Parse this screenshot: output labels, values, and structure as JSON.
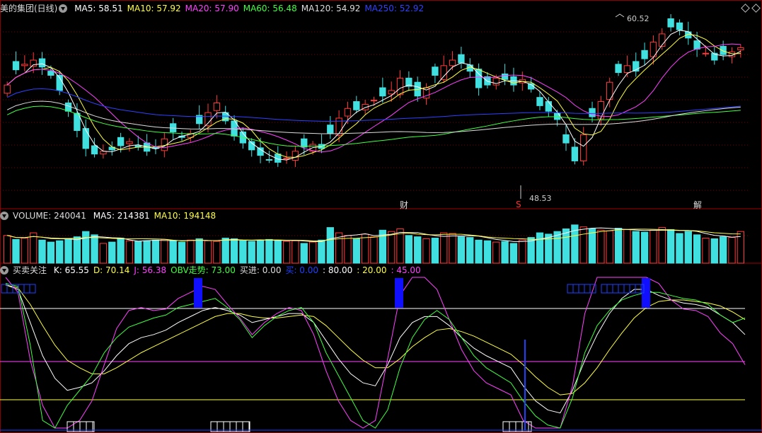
{
  "price_panel": {
    "title": "美的集团(日线)",
    "ma": [
      {
        "label": "MA5: 58.51",
        "color": "#ffffff"
      },
      {
        "label": "MA10: 57.92",
        "color": "#ffff40"
      },
      {
        "label": "MA20: 57.90",
        "color": "#ff40ff"
      },
      {
        "label": "MA60: 56.48",
        "color": "#40ff40"
      },
      {
        "label": "MA120: 54.92",
        "color": "#dddddd"
      },
      {
        "label": "MA250: 52.92",
        "color": "#3040ff"
      }
    ],
    "high_label": "60.52",
    "low_label": "48.53",
    "events": [
      {
        "text": "财",
        "color": "#e0e0e0"
      },
      {
        "text": "S",
        "color": "#ff3030"
      },
      {
        "text": "解",
        "color": "#e0e0e0"
      }
    ]
  },
  "volume_panel": {
    "title": "VOLUME: 240041",
    "ma": [
      {
        "label": "MA5: 214381",
        "color": "#ffffff"
      },
      {
        "label": "MA10: 194148",
        "color": "#ffff40"
      }
    ]
  },
  "indicator_panel": {
    "title": "买卖关注",
    "fields": [
      {
        "label": "K: 65.55",
        "color": "#ffffff"
      },
      {
        "label": "D: 70.14",
        "color": "#ffff40"
      },
      {
        "label": "J: 56.38",
        "color": "#ff40ff"
      },
      {
        "label": "OBV走势: 73.00",
        "color": "#40ff40"
      },
      {
        "label": "买进: 0.00",
        "color": "#dddddd"
      },
      {
        "label": "买: 0.00",
        "color": "#2040ff"
      },
      {
        "label": ": 80.00",
        "color": "#ffffff"
      },
      {
        "label": ": 20.00",
        "color": "#ffff40"
      },
      {
        "label": ": 45.00",
        "color": "#ff40ff"
      }
    ]
  },
  "chart_data": [
    {
      "type": "candlestick",
      "title": "美的集团(日线)",
      "bars": 85,
      "price_range": [
        48.53,
        60.52
      ],
      "close_series": [
        55.8,
        56.9,
        57.3,
        57.6,
        57.1,
        56.5,
        55.4,
        53.9,
        52.5,
        51.2,
        50.8,
        51.0,
        51.1,
        51.4,
        51.7,
        51.3,
        51.0,
        51.2,
        51.9,
        52.4,
        52.0,
        52.3,
        53.0,
        53.8,
        54.5,
        53.2,
        52.1,
        51.6,
        51.1,
        50.7,
        50.4,
        50.2,
        50.5,
        51.0,
        51.3,
        51.5,
        51.2,
        52.3,
        53.4,
        54.1,
        54.0,
        54.4,
        54.7,
        55.0,
        55.4,
        56.3,
        55.7,
        55.0,
        55.6,
        56.5,
        57.2,
        57.6,
        57.4,
        56.8,
        55.6,
        55.8,
        56.3,
        56.2,
        55.8,
        56.2,
        55.5,
        54.3,
        53.9,
        53.3,
        51.6,
        50.3,
        52.2,
        53.5,
        54.6,
        56.0,
        56.7,
        57.2,
        56.8,
        57.7,
        58.9,
        59.5,
        60.0,
        59.8,
        59.2,
        58.4,
        58.1,
        57.6,
        58.0,
        58.2,
        58.5
      ],
      "ma_values": {
        "MA5": 58.51,
        "MA10": 57.92,
        "MA20": 57.9,
        "MA60": 56.48,
        "MA120": 54.92,
        "MA250": 52.92
      }
    },
    {
      "type": "bar",
      "title": "VOLUME",
      "values": [
        210000,
        180000,
        190000,
        230000,
        175000,
        160000,
        170000,
        185000,
        200000,
        240000,
        215000,
        150000,
        160000,
        190000,
        170000,
        165000,
        170000,
        175000,
        180000,
        170000,
        160000,
        175000,
        185000,
        170000,
        165000,
        190000,
        185000,
        170000,
        165000,
        175000,
        180000,
        175000,
        165000,
        170000,
        150000,
        160000,
        175000,
        270000,
        230000,
        210000,
        185000,
        220000,
        200000,
        250000,
        240000,
        260000,
        210000,
        200000,
        185000,
        190000,
        230000,
        225000,
        200000,
        195000,
        175000,
        170000,
        160000,
        165000,
        150000,
        175000,
        195000,
        230000,
        220000,
        240000,
        260000,
        290000,
        275000,
        260000,
        250000,
        245000,
        265000,
        255000,
        240000,
        235000,
        250000,
        270000,
        255000,
        225000,
        240000,
        215000,
        190000,
        185000,
        200000,
        195000,
        240041
      ],
      "ma_values": {
        "MA5": 214381,
        "MA10": 194148
      }
    },
    {
      "type": "line",
      "title": "买卖关注",
      "series": [
        {
          "name": "K",
          "values": [
            95,
            92,
            70,
            48,
            33,
            25,
            27,
            30,
            38,
            48,
            56,
            60,
            62,
            65,
            70,
            74,
            78,
            80,
            78,
            75,
            70,
            72,
            74,
            76,
            76,
            70,
            58,
            46,
            36,
            30,
            28,
            42,
            60,
            70,
            74,
            74,
            68,
            60,
            53,
            48,
            44,
            40,
            28,
            18,
            12,
            10,
            25,
            45,
            62,
            76,
            86,
            92,
            92,
            88,
            85,
            83,
            82,
            80,
            75,
            70,
            62
          ]
        },
        {
          "name": "D",
          "values": [
            95,
            93,
            82,
            68,
            55,
            45,
            40,
            36,
            36,
            40,
            45,
            50,
            54,
            58,
            62,
            66,
            70,
            74,
            76,
            76,
            74,
            73,
            73,
            74,
            75,
            74,
            68,
            60,
            52,
            45,
            40,
            40,
            46,
            54,
            60,
            65,
            66,
            64,
            61,
            57,
            53,
            49,
            42,
            34,
            27,
            22,
            23,
            30,
            40,
            52,
            63,
            73,
            80,
            84,
            85,
            85,
            84,
            83,
            81,
            77,
            72
          ]
        },
        {
          "name": "J",
          "values": [
            100,
            90,
            45,
            15,
            0,
            0,
            5,
            18,
            42,
            66,
            78,
            80,
            78,
            79,
            86,
            90,
            94,
            92,
            82,
            73,
            62,
            70,
            76,
            80,
            78,
            62,
            38,
            18,
            5,
            0,
            5,
            46,
            88,
            100,
            100,
            92,
            72,
            52,
            38,
            30,
            26,
            22,
            5,
            0,
            0,
            0,
            28,
            76,
            100,
            100,
            100,
            100,
            100,
            96,
            85,
            79,
            78,
            74,
            63,
            56,
            42
          ]
        },
        {
          "name": "OBV走势",
          "values": [
            96,
            94,
            55,
            5,
            0,
            15,
            25,
            35,
            50,
            60,
            67,
            70,
            73,
            75,
            80,
            82,
            84,
            86,
            80,
            72,
            60,
            68,
            74,
            78,
            80,
            70,
            50,
            35,
            20,
            5,
            0,
            12,
            40,
            60,
            72,
            78,
            72,
            60,
            48,
            40,
            35,
            30,
            18,
            8,
            2,
            0,
            20,
            50,
            68,
            78,
            85,
            88,
            90,
            90,
            88,
            86,
            85,
            82,
            75,
            70,
            73
          ]
        }
      ],
      "reference_lines": [
        80,
        20,
        45
      ],
      "signals": [
        "buy",
        "sell",
        "sell"
      ]
    }
  ]
}
